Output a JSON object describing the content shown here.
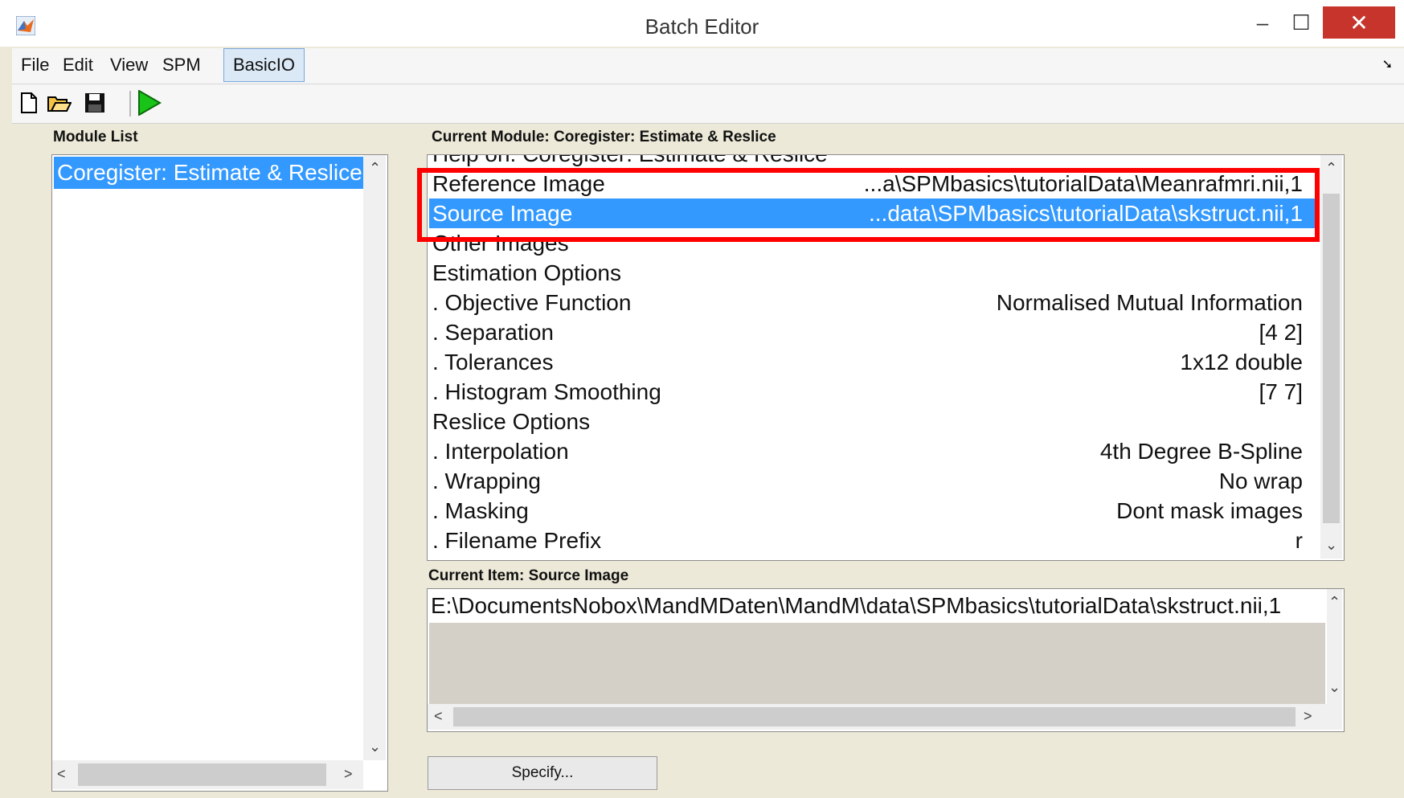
{
  "window": {
    "title": "Batch Editor"
  },
  "menu": {
    "items": [
      "File",
      "Edit",
      "View",
      "SPM",
      "BasicIO"
    ],
    "active_index": 4
  },
  "toolbar": {
    "icons": [
      "new-file-icon",
      "open-folder-icon",
      "save-icon",
      "run-icon"
    ]
  },
  "module_list": {
    "label": "Module List",
    "items": [
      "Coregister: Estimate & Reslice"
    ]
  },
  "current_module": {
    "label": "Current Module: Coregister: Estimate & Reslice",
    "rows": [
      {
        "label": "Help on: Coregister: Estimate & Reslice",
        "value": ""
      },
      {
        "label": "Reference Image",
        "value": "...a\\SPMbasics\\tutorialData\\Meanrafmri.nii,1"
      },
      {
        "label": "Source Image",
        "value": "...data\\SPMbasics\\tutorialData\\skstruct.nii,1",
        "selected": true
      },
      {
        "label": "Other Images",
        "value": ""
      },
      {
        "label": "Estimation Options",
        "value": ""
      },
      {
        "label": ". Objective Function",
        "value": "Normalised Mutual Information"
      },
      {
        "label": ". Separation",
        "value": "[4 2]"
      },
      {
        "label": ". Tolerances",
        "value": "1x12 double"
      },
      {
        "label": ". Histogram Smoothing",
        "value": "[7 7]"
      },
      {
        "label": "Reslice Options",
        "value": ""
      },
      {
        "label": ". Interpolation",
        "value": "4th Degree B-Spline"
      },
      {
        "label": ". Wrapping",
        "value": "No wrap"
      },
      {
        "label": ". Masking",
        "value": "Dont mask images"
      },
      {
        "label": ". Filename Prefix",
        "value": "r"
      }
    ]
  },
  "current_item": {
    "label": "Current Item: Source Image",
    "value": "E:\\DocumentsNobox\\MandMDaten\\MandM\\data\\SPMbasics\\tutorialData\\skstruct.nii,1"
  },
  "specify_button": {
    "label": "Specify..."
  },
  "colors": {
    "selection": "#3399ff",
    "highlight_box": "#ff0000",
    "window_bg": "#ece9d8",
    "close_button": "#c7342c"
  }
}
